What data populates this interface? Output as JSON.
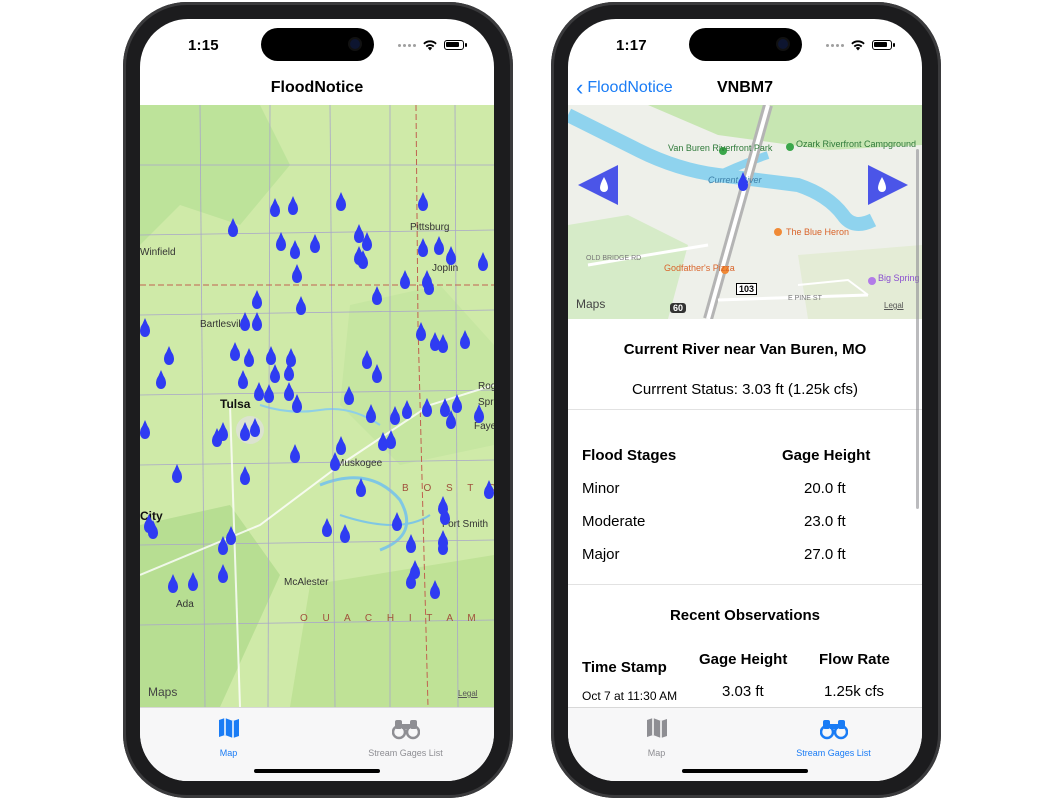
{
  "left_phone": {
    "status_time": "1:15",
    "nav_title": "FloodNotice",
    "map": {
      "labels": [
        "Winfield",
        "Pittsburg",
        "Joplin",
        "Bartlesville",
        "Tulsa",
        "Muskogee",
        "Rog",
        "Spr",
        "Faye",
        "City",
        "Fort Smith",
        "McAlester",
        "Ada"
      ],
      "region_labels": [
        "B O S T O",
        "O U A C H I T A  M"
      ],
      "logo": "Maps",
      "legal": "Legal",
      "pin_color": "#2f3cf2"
    },
    "tabs": [
      {
        "label": "Map",
        "icon": "map-icon",
        "active": true
      },
      {
        "label": "Stream Gages List",
        "icon": "binoculars-icon",
        "active": false
      }
    ]
  },
  "right_phone": {
    "status_time": "1:17",
    "back_label": "FloodNotice",
    "nav_title": "VNBM7",
    "map": {
      "labels": [
        "Van Buren\nRiverfront Park",
        "Ozark Riverfront\nCampground",
        "Current River",
        "The Blue Heron",
        "OLD BRIDGE RD",
        "Godfather's\nPizza",
        "103",
        "E PINE ST",
        "Big Spring\nRV Camp",
        "60"
      ],
      "logo": "Maps",
      "legal": "Legal"
    },
    "gage_name": "Current River near Van Buren, MO",
    "current_status": "Currrent Status: 3.03 ft (1.25k cfs)",
    "flood_stages": {
      "col_stage": "Flood Stages",
      "col_height": "Gage Height",
      "rows": [
        {
          "stage": "Minor",
          "height": "20.0 ft"
        },
        {
          "stage": "Moderate",
          "height": "23.0 ft"
        },
        {
          "stage": "Major",
          "height": "27.0 ft"
        }
      ]
    },
    "recent": {
      "title": "Recent Observations",
      "col_time": "Time Stamp",
      "col_height": "Gage Height",
      "col_flow": "Flow Rate",
      "rows": [
        {
          "time": "Oct 7 at 11:30 AM",
          "height": "3.03 ft",
          "flow": "1.25k cfs"
        }
      ]
    },
    "tabs": [
      {
        "label": "Map",
        "icon": "map-icon",
        "active": false
      },
      {
        "label": "Stream Gages List",
        "icon": "binoculars-icon",
        "active": true
      }
    ]
  },
  "colors": {
    "accent": "#1a7cf5",
    "pin": "#2f3cf2",
    "map_land": "#cfeaa8"
  }
}
